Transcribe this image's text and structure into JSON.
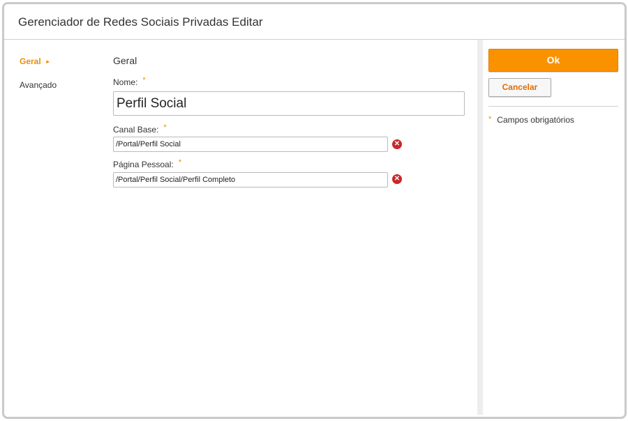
{
  "window": {
    "title": "Gerenciador de Redes Sociais Privadas Editar"
  },
  "sidebar": {
    "items": [
      {
        "label": "Geral",
        "active": true
      },
      {
        "label": "Avançado",
        "active": false
      }
    ]
  },
  "form": {
    "section_title": "Geral",
    "required_mark": "*",
    "fields": {
      "nome": {
        "label": "Nome:",
        "value": "Perfil Social"
      },
      "canal_base": {
        "label": "Canal Base:",
        "value": "/Portal/Perfil Social"
      },
      "pagina_pessoal": {
        "label": "Página Pessoal:",
        "value": "/Portal/Perfil Social/Perfil Completo"
      }
    }
  },
  "actions": {
    "ok_label": "Ok",
    "cancel_label": "Cancelar"
  },
  "legend": {
    "required_fields": "Campos obrigatórios",
    "mark": "*"
  },
  "colors": {
    "accent": "#f08c00",
    "ok_button": "#fa9200",
    "clear_icon": "#c8282a"
  },
  "icons": {
    "active_item": "triangle-right-icon",
    "clear": "close-circle-icon"
  }
}
